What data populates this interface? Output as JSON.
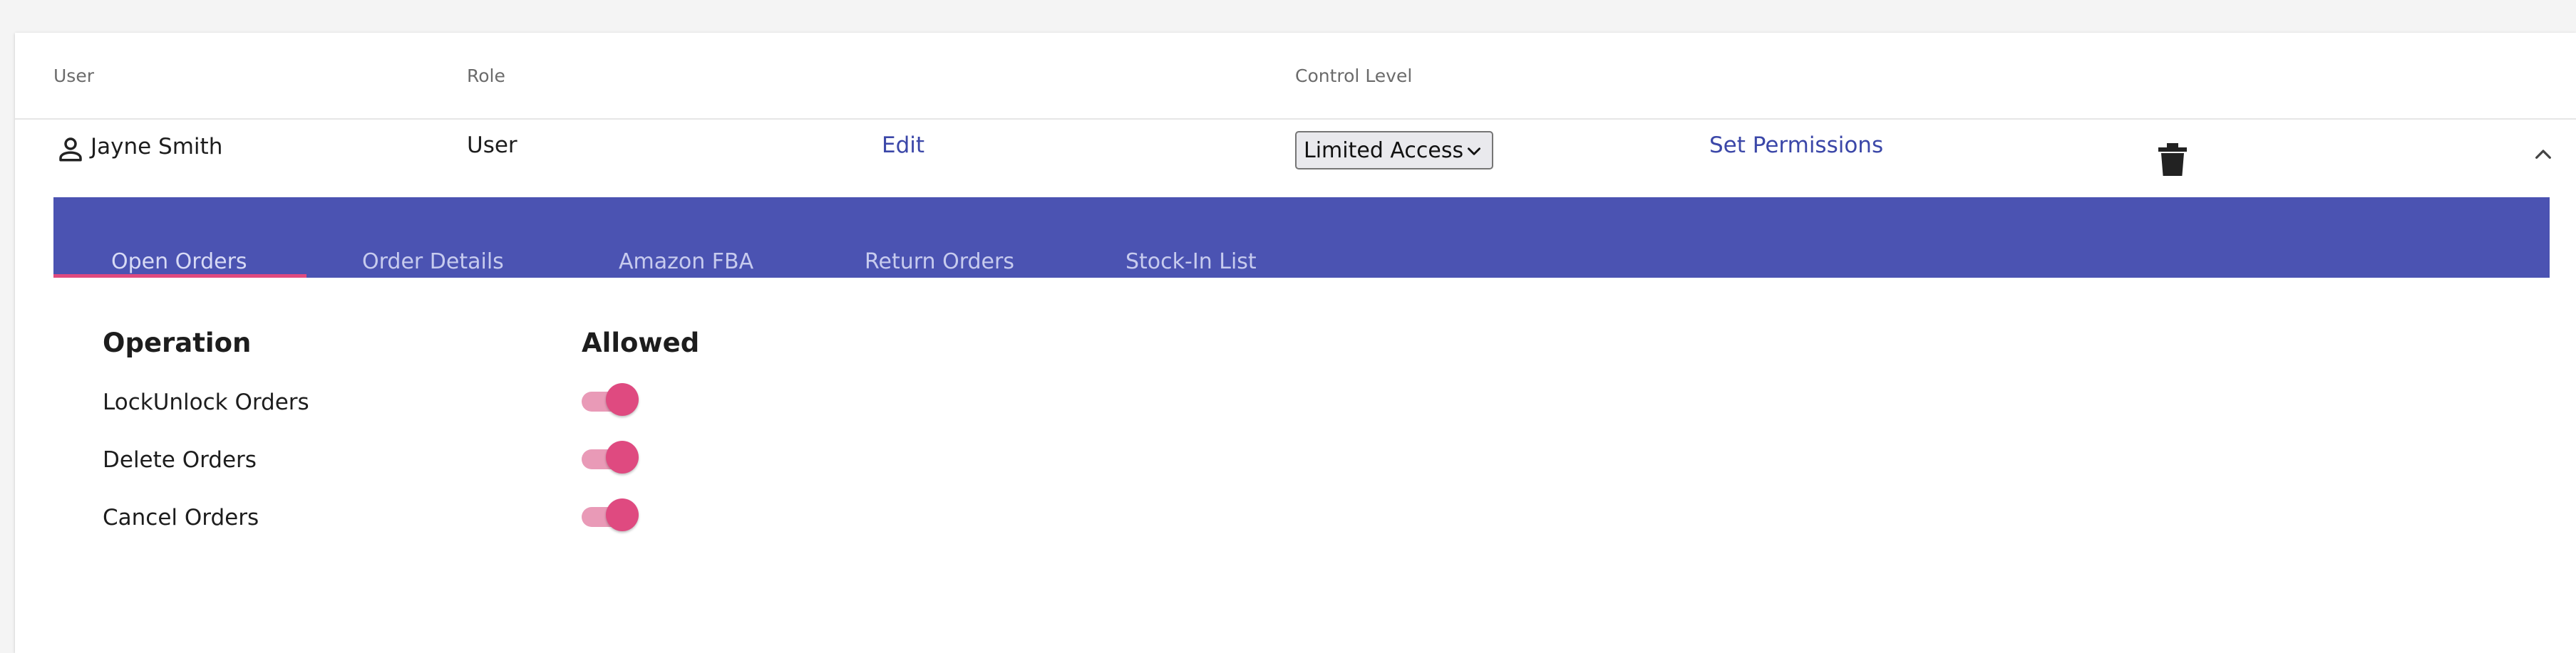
{
  "table": {
    "headers": {
      "user": "User",
      "role": "Role",
      "control_level": "Control Level"
    },
    "row": {
      "user_icon": "person-icon",
      "user_name": "Jayne Smith",
      "role": "User",
      "edit_label": "Edit",
      "control_level_value": "Limited Access",
      "set_permissions_label": "Set Permissions",
      "delete_icon": "trash-icon",
      "collapse_icon": "chevron-up-icon"
    }
  },
  "tabs": [
    {
      "label": "Open Orders",
      "active": true
    },
    {
      "label": "Order Details",
      "active": false
    },
    {
      "label": "Amazon FBA",
      "active": false
    },
    {
      "label": "Return Orders",
      "active": false
    },
    {
      "label": "Stock-In List",
      "active": false
    }
  ],
  "permissions": {
    "operation_header": "Operation",
    "allowed_header": "Allowed",
    "items": [
      {
        "label": "LockUnlock Orders",
        "allowed": true
      },
      {
        "label": "Delete Orders",
        "allowed": true
      },
      {
        "label": "Cancel Orders",
        "allowed": true
      }
    ]
  },
  "colors": {
    "accent": "#4b53b2",
    "toggle": "#df4a80",
    "link": "#3b47a8"
  }
}
